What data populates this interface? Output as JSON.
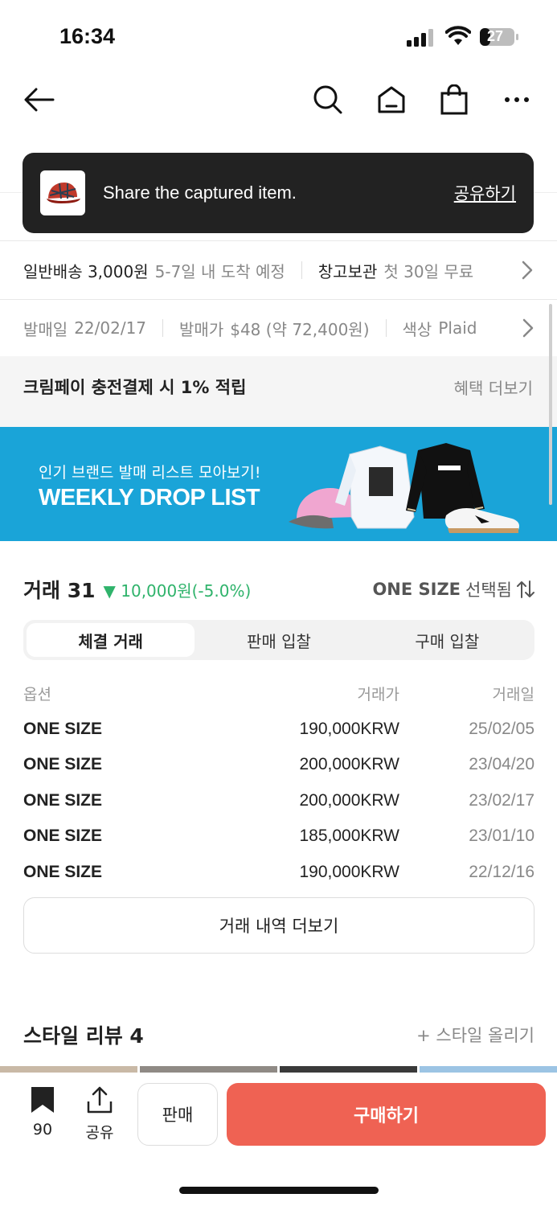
{
  "status_bar": {
    "time": "16:34",
    "battery": "27"
  },
  "icons": {
    "back": "back-arrow-icon",
    "search": "search-icon",
    "home": "home-icon",
    "bag": "shopping-bag-icon",
    "more": "more-dots-icon",
    "chevron": "chevron-right-icon",
    "sort": "sort-arrows-icon",
    "bookmark": "bookmark-icon",
    "share": "share-icon"
  },
  "toast": {
    "message": "Share the captured item.",
    "action": "공유하기"
  },
  "shipping": {
    "general_label": "일반배송 3,000원",
    "general_eta": "5-7일 내 도착 예정",
    "warehouse_label": "창고보관",
    "warehouse_note": "첫 30일 무료"
  },
  "info": {
    "release_date_label": "발매일",
    "release_date": "22/02/17",
    "release_price_label": "발매가",
    "release_price": "$48 (약 72,400원)",
    "color_label": "색상",
    "color": "Plaid"
  },
  "benefit": {
    "title": "크림페이 충전결제 시 1% 적립",
    "more": "혜택 더보기"
  },
  "banner": {
    "subtitle": "인기 브랜드 발매 리스트 모아보기!",
    "title": "WEEKLY DROP LIST",
    "bg_color": "#1aa4d8"
  },
  "trades": {
    "title": "거래 31",
    "change": "▼ 10,000원(-5.0%)",
    "change_color": "#2fb36b",
    "size_selected_bold": "ONE SIZE",
    "size_selected_suffix": "선택됨",
    "tabs": [
      "체결 거래",
      "판매 입찰",
      "구매 입찰"
    ],
    "active_tab": 0,
    "columns": [
      "옵션",
      "거래가",
      "거래일"
    ],
    "rows": [
      {
        "option": "ONE SIZE",
        "price": "190,000KRW",
        "date": "25/02/05"
      },
      {
        "option": "ONE SIZE",
        "price": "200,000KRW",
        "date": "23/04/20"
      },
      {
        "option": "ONE SIZE",
        "price": "200,000KRW",
        "date": "23/02/17"
      },
      {
        "option": "ONE SIZE",
        "price": "185,000KRW",
        "date": "23/01/10"
      },
      {
        "option": "ONE SIZE",
        "price": "190,000KRW",
        "date": "22/12/16"
      }
    ],
    "more_button": "거래 내역 더보기"
  },
  "style_review": {
    "title": "스타일 리뷰 4",
    "upload": "+ 스타일 올리기"
  },
  "bottom_bar": {
    "bookmark_count": "90",
    "share_label": "공유",
    "sell_label": "판매",
    "buy_label": "구매하기",
    "buy_color": "#ef6253"
  }
}
